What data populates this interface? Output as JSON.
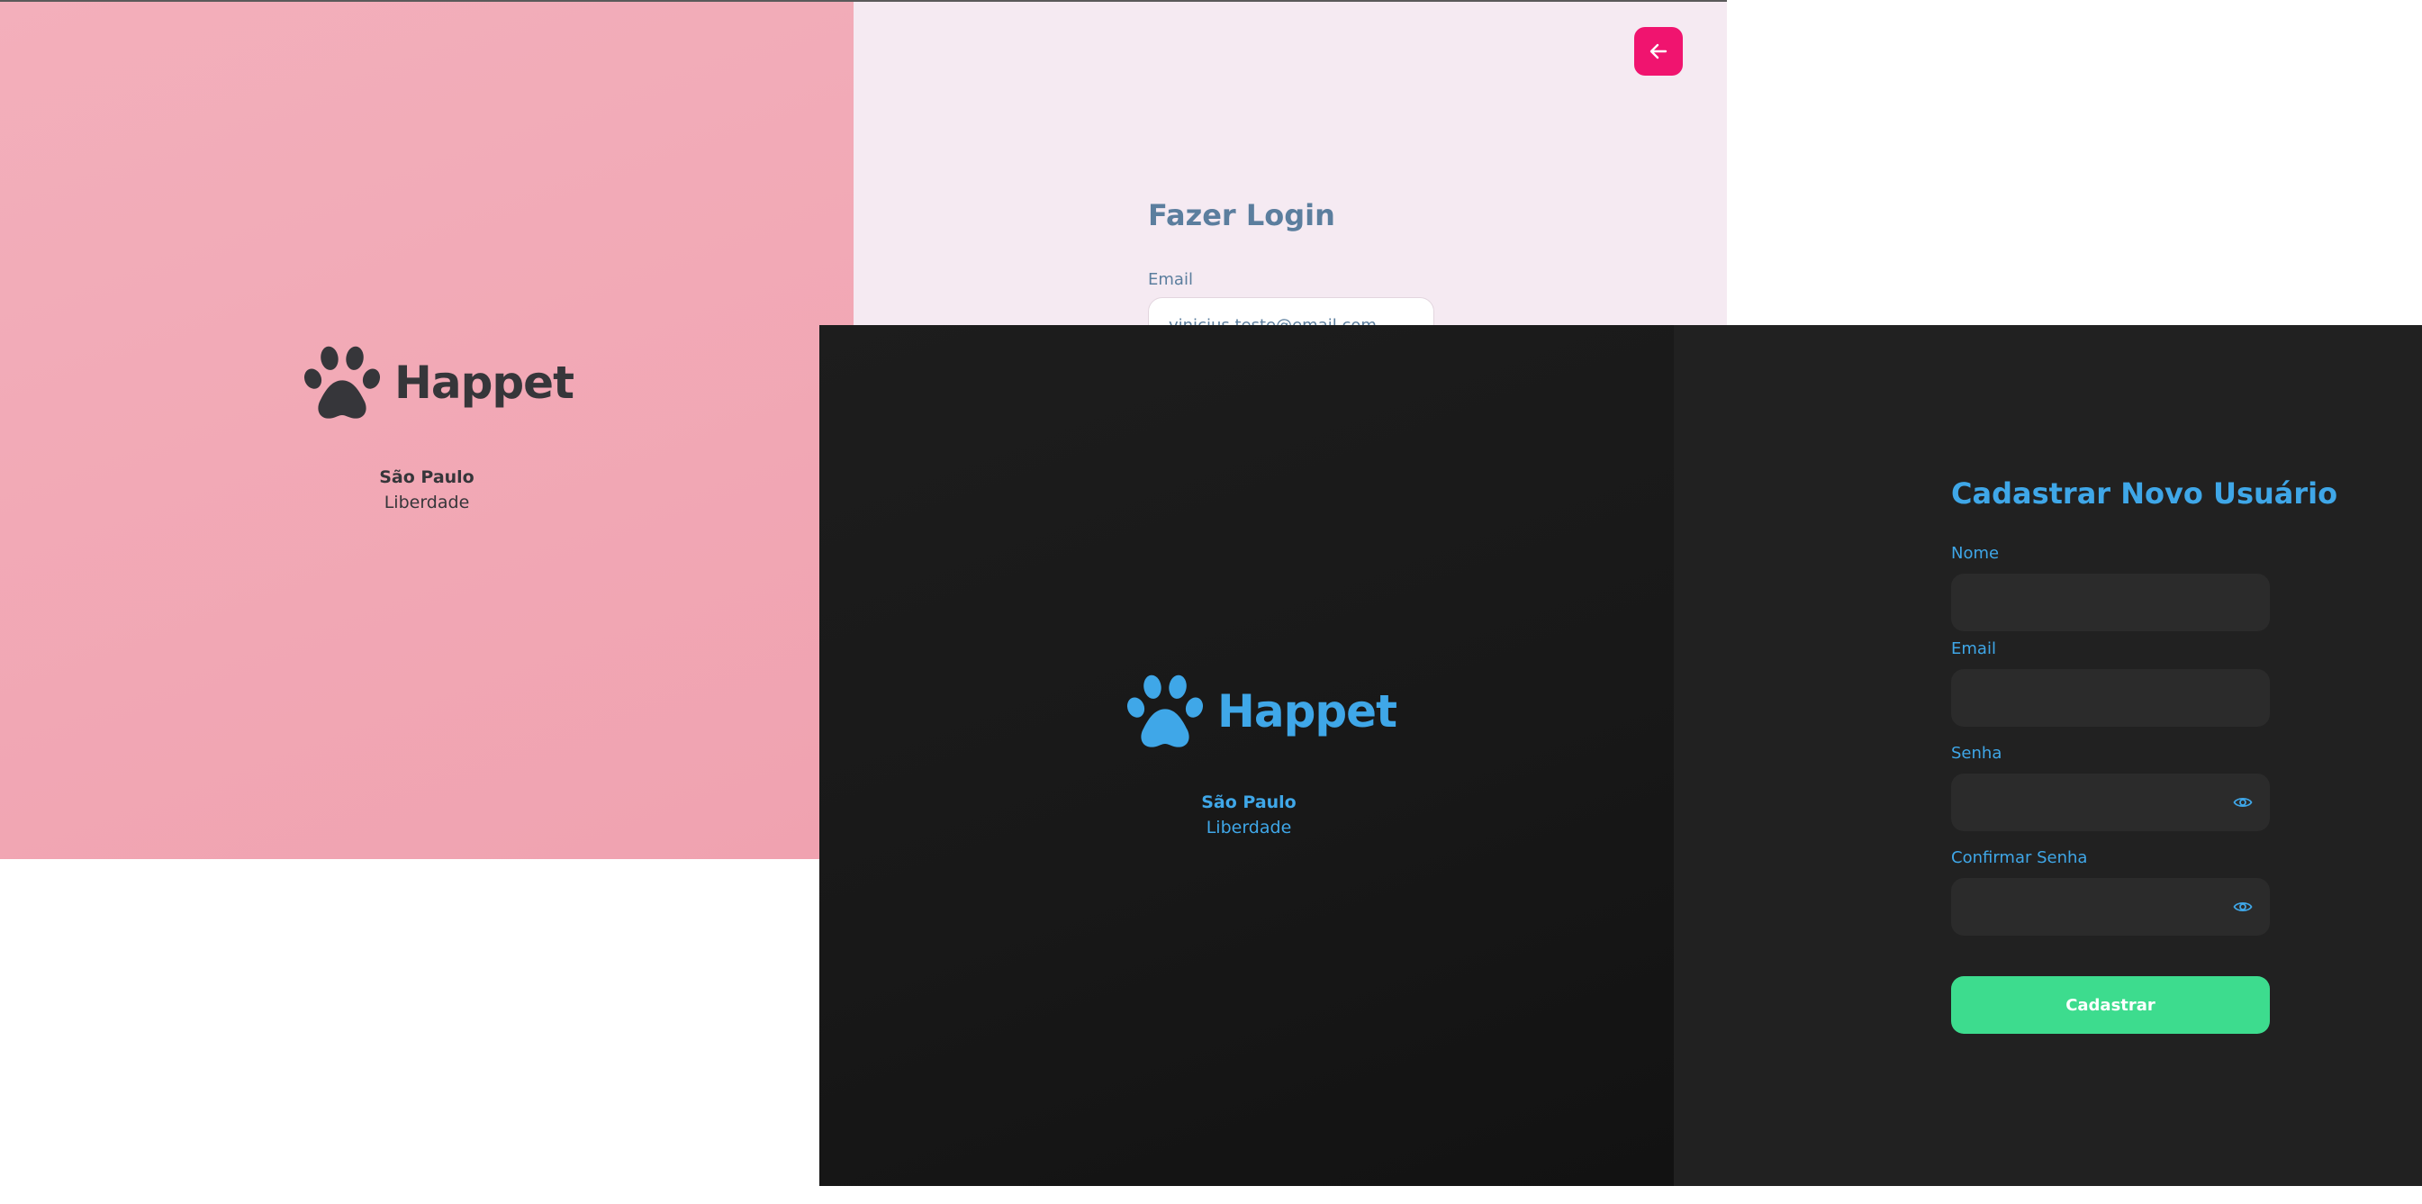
{
  "login_window": {
    "brand": {
      "name": "Happet",
      "city": "São Paulo",
      "district": "Liberdade",
      "logo_icon": "paw-icon",
      "color": "#36363a",
      "background": "#f0a2b0"
    },
    "back_button": {
      "icon": "arrow-left-icon",
      "color": "#f0146f"
    },
    "title": "Fazer Login",
    "email_label": "Email",
    "email_value": "vinicius.teste@email.com",
    "panel_background": "#f5eaf2",
    "accent_text": "#5b7e9e"
  },
  "register_window": {
    "brand": {
      "name": "Happet",
      "city": "São Paulo",
      "district": "Liberdade",
      "logo_icon": "paw-icon",
      "color": "#3fa7e8",
      "background": "#1a1a1a"
    },
    "title": "Cadastrar Novo Usuário",
    "fields": {
      "nome": {
        "label": "Nome",
        "value": ""
      },
      "email": {
        "label": "Email",
        "value": ""
      },
      "senha": {
        "label": "Senha",
        "value": "",
        "toggle_icon": "eye-icon"
      },
      "confirmar_senha": {
        "label": "Confirmar Senha",
        "value": "",
        "toggle_icon": "eye-icon"
      }
    },
    "submit_label": "Cadastrar",
    "submit_color": "#3ddc8e",
    "panel_background": "#212121",
    "field_background": "#2b2b2b"
  }
}
